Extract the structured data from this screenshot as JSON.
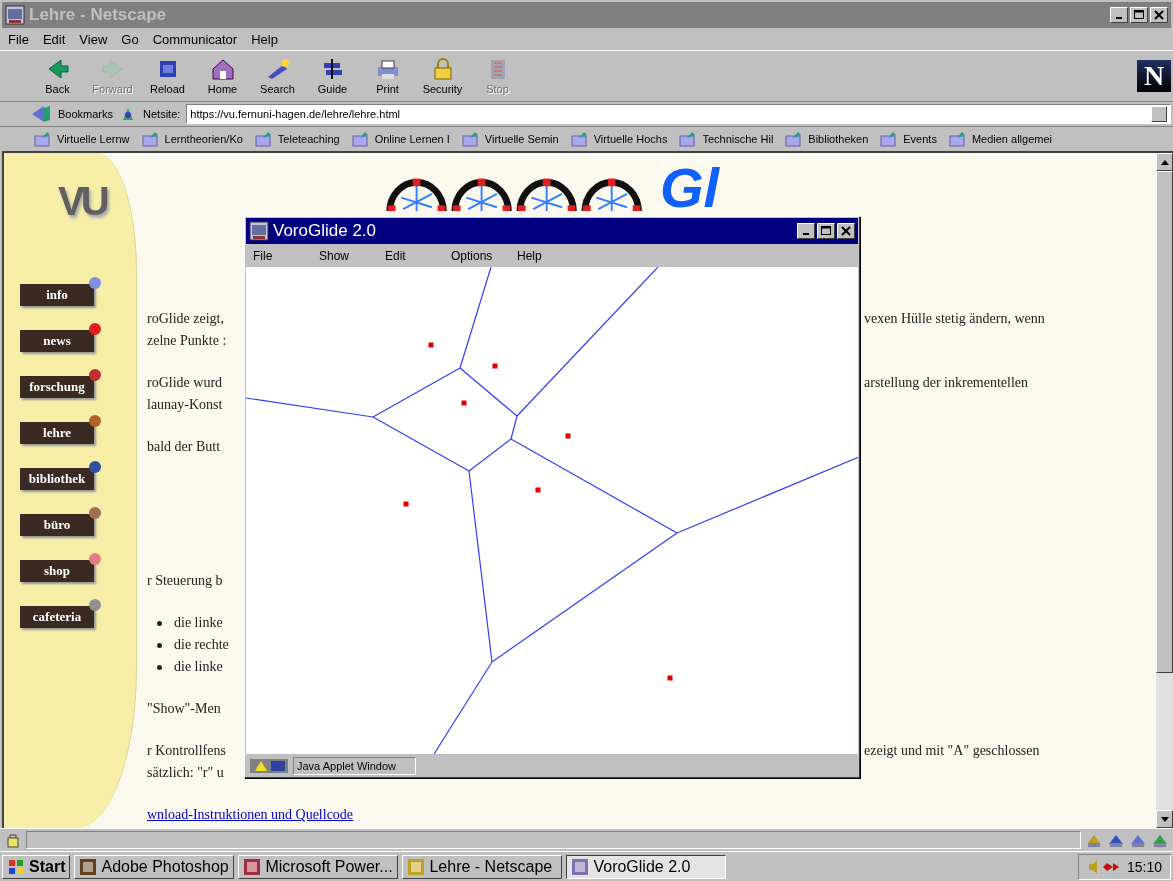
{
  "browser_window": {
    "title": "Lehre - Netscape",
    "active": false
  },
  "menu": [
    "File",
    "Edit",
    "View",
    "Go",
    "Communicator",
    "Help"
  ],
  "toolbar": [
    {
      "label": "Back",
      "disabled": false
    },
    {
      "label": "Forward",
      "disabled": true
    },
    {
      "label": "Reload",
      "disabled": false
    },
    {
      "label": "Home",
      "disabled": false
    },
    {
      "label": "Search",
      "disabled": false
    },
    {
      "label": "Guide",
      "disabled": false
    },
    {
      "label": "Print",
      "disabled": false
    },
    {
      "label": "Security",
      "disabled": false
    },
    {
      "label": "Stop",
      "disabled": true
    }
  ],
  "netscape_logo": "N",
  "location": {
    "bookmarks_label": "Bookmarks",
    "field_label": "Netsite:",
    "url": "https://vu.fernuni-hagen.de/lehre/lehre.html"
  },
  "personal_toolbar": [
    "Virtuelle Lernw",
    "Lerntheorien/Ko",
    "Teleteaching",
    "Online Lernen I",
    "Virtuelle Semin",
    "Virtuelle Hochs",
    "Technische Hil",
    "Bibliotheken",
    "Events",
    "Medien allgemei"
  ],
  "sidebar": {
    "logo": "VU",
    "items": [
      "info",
      "news",
      "forschung",
      "lehre",
      "bibliothek",
      "büro",
      "shop",
      "cafeteria"
    ]
  },
  "page": {
    "logo_text": "Gl",
    "paragraphs": [
      {
        "kind": "text",
        "lines": [
          {
            "left": "roGlide zeigt,",
            "right": "vexen Hülle stetig ändern, wenn"
          },
          {
            "left": "zelne Punkte :"
          }
        ]
      },
      {
        "kind": "text",
        "lines": [
          {
            "left": "roGlide wurd",
            "right": "arstellung der inkrementellen"
          },
          {
            "left": "launay-Konst"
          }
        ]
      },
      {
        "kind": "text",
        "lines": [
          {
            "left": "bald der Butt"
          }
        ]
      },
      {
        "kind": "text",
        "lines": [
          {
            "left": "r Steuerung b"
          }
        ]
      },
      {
        "kind": "bullets",
        "lines": [
          {
            "left": "die linke"
          },
          {
            "left": "die rechte"
          },
          {
            "left": "die linke"
          }
        ]
      },
      {
        "kind": "text",
        "lines": [
          {
            "left": "\"Show\"-Men"
          }
        ]
      },
      {
        "kind": "text",
        "lines": [
          {
            "left": "r Kontrollfens",
            "right": "ezeigt und mit \"A\" geschlossen"
          },
          {
            "left": "sätzlich: \"r\" u"
          }
        ]
      },
      {
        "kind": "link",
        "lines": [
          {
            "left": "wnload-Instruktionen und Quellcode"
          }
        ]
      }
    ]
  },
  "applet_window": {
    "title": "VoroGlide 2.0",
    "active": true,
    "menu": [
      "File",
      "Show",
      "Edit",
      "Options",
      "Help"
    ],
    "status": "Java Applet Window"
  },
  "taskbar": {
    "start": "Start",
    "tasks": [
      {
        "label": "Adobe Photoshop",
        "selected": false
      },
      {
        "label": "Microsoft Power...",
        "selected": false
      },
      {
        "label": "Lehre - Netscape",
        "selected": false
      },
      {
        "label": "VoroGlide 2.0",
        "selected": true
      }
    ],
    "clock": "15:10"
  }
}
